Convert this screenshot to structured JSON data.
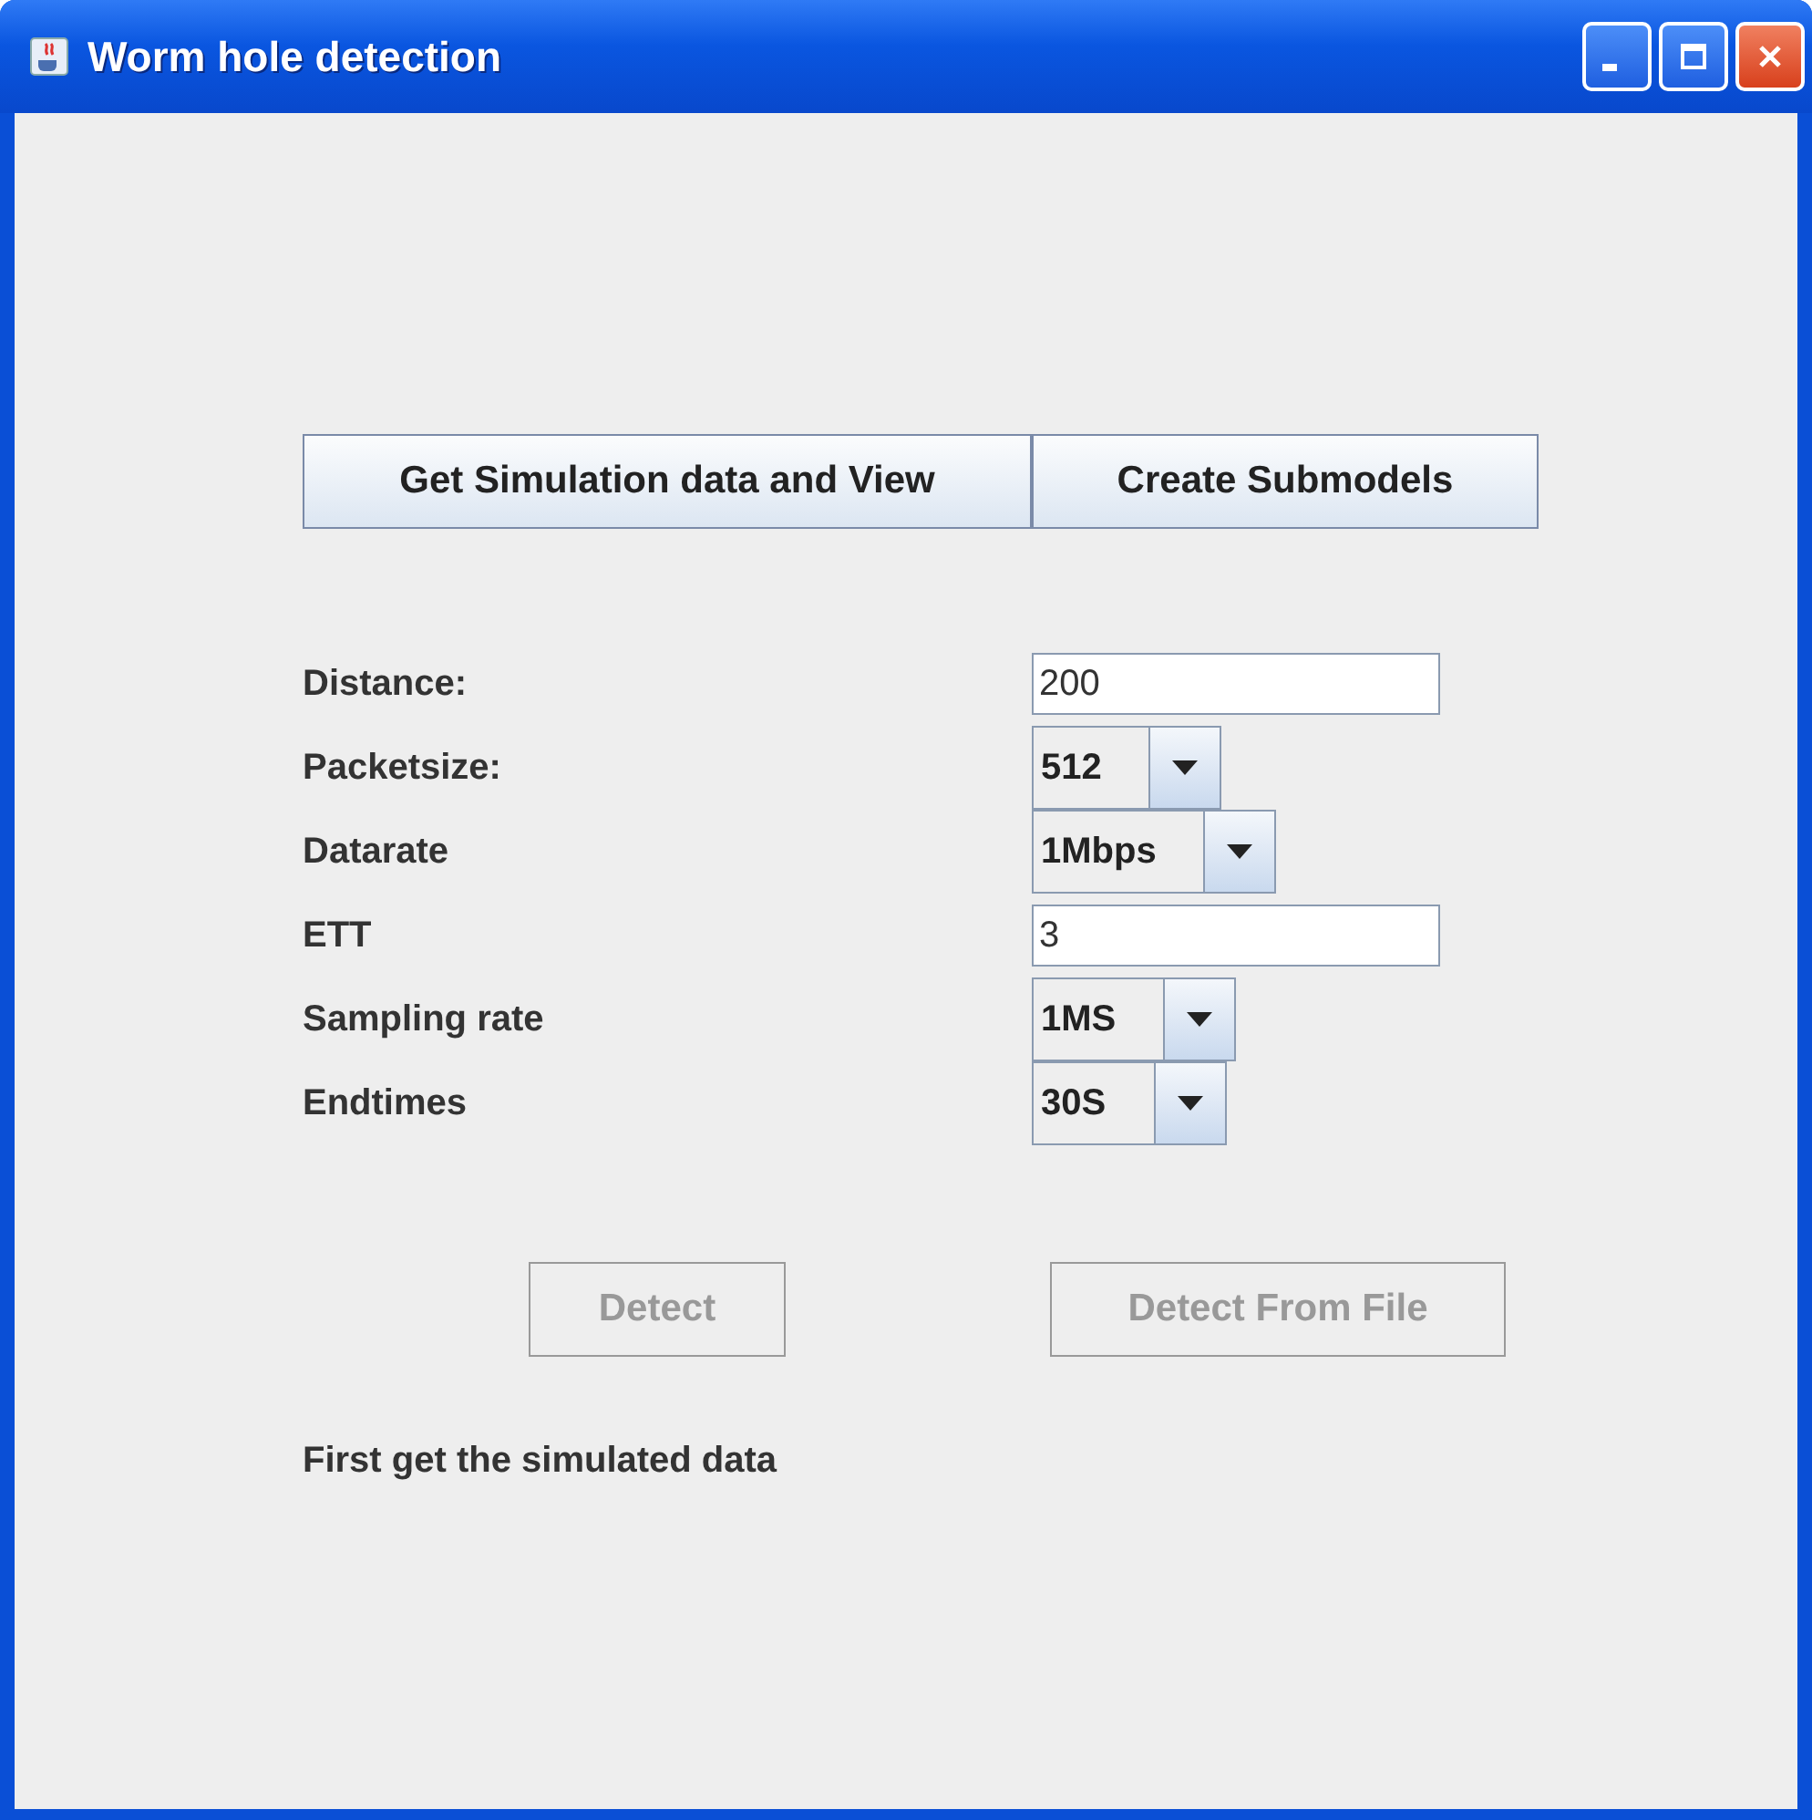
{
  "window": {
    "title": "Worm hole detection"
  },
  "top_buttons": [
    {
      "label": "Get Simulation data and View",
      "disabled": false
    },
    {
      "label": "Create Submodels",
      "disabled": false
    }
  ],
  "form": [
    {
      "kind": "text",
      "label": "Distance:",
      "value": "200"
    },
    {
      "kind": "combo",
      "label": "Packetsize:",
      "value": "512"
    },
    {
      "kind": "combo",
      "label": "Datarate",
      "value": "1Mbps"
    },
    {
      "kind": "text",
      "label": "ETT",
      "value": "3"
    },
    {
      "kind": "combo",
      "label": "Sampling rate",
      "value": "1MS"
    },
    {
      "kind": "combo",
      "label": "Endtimes",
      "value": "30S"
    }
  ],
  "detect_buttons": [
    {
      "label": "Detect",
      "disabled": true
    },
    {
      "label": "Detect From File",
      "disabled": true
    }
  ],
  "status": "First get the simulated data"
}
